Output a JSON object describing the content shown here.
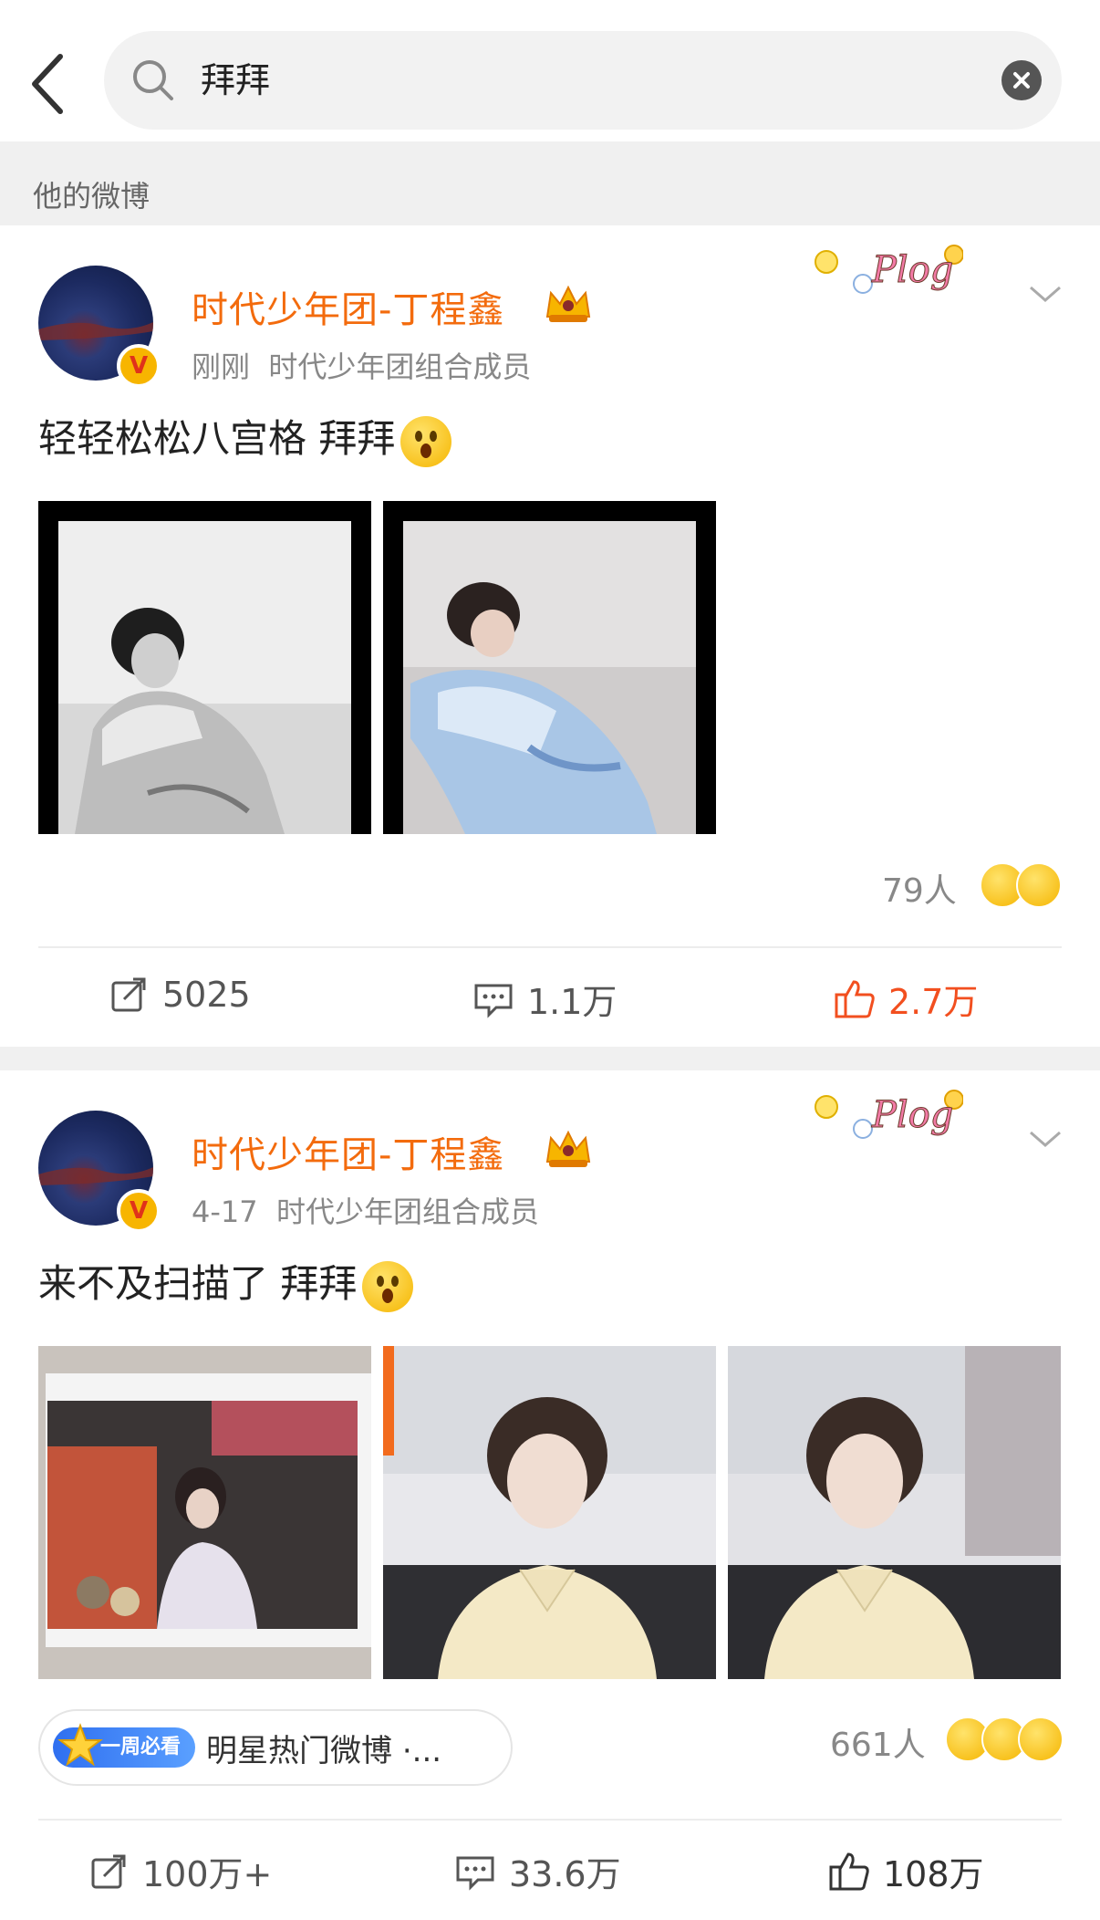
{
  "header": {
    "back_icon": "chevron-left-icon",
    "search_query": "拜拜",
    "search_icon": "search-icon",
    "clear_icon": "close-icon"
  },
  "section": {
    "label": "他的微博"
  },
  "posts": [
    {
      "username": "时代少年团-丁程鑫",
      "time": "刚刚",
      "source": "时代少年团组合成员",
      "text": "轻轻松松八宫格 拜拜",
      "badge": "Plog",
      "images": [
        {
          "desc": "black-and-white portrait photo"
        },
        {
          "desc": "color portrait photo in blue floral shirt"
        }
      ],
      "reactions_count": "79人",
      "actions": {
        "repost": "5025",
        "comment": "1.1万",
        "like": "2.7万"
      },
      "like_color": "#f24f1f"
    },
    {
      "username": "时代少年团-丁程鑫",
      "time": "4-17",
      "source": "时代少年团组合成员",
      "text": "来不及扫描了 拜拜",
      "badge": "Plog",
      "images": [
        {
          "desc": "polaroid photo"
        },
        {
          "desc": "photo in cream shirt"
        },
        {
          "desc": "photo in cream shirt, side"
        }
      ],
      "tag": {
        "badge": "一周必看",
        "text": "明星热门微博 ·..."
      },
      "reactions_count": "661人",
      "actions": {
        "repost": "100万+",
        "comment": "33.6万",
        "like": "108万"
      },
      "like_color": "#333333"
    }
  ],
  "colors": {
    "accent": "#f36b0d",
    "verified": "#f7b500",
    "like_active": "#f24f1f"
  }
}
